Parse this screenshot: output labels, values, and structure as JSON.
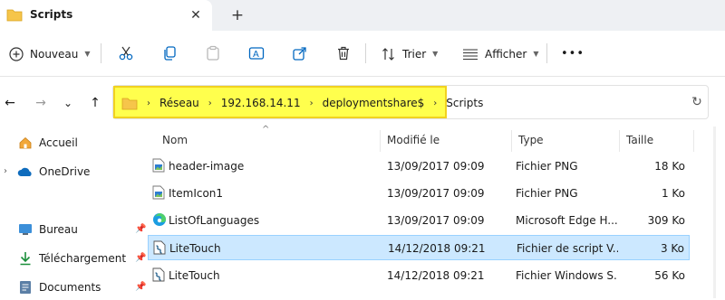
{
  "tab": {
    "title": "Scripts",
    "close": "✕",
    "new_tab": "+"
  },
  "toolbar": {
    "new_label": "Nouveau",
    "sort_label": "Trier",
    "view_label": "Afficher",
    "more": "•••"
  },
  "nav": {
    "back": "←",
    "forward": "→",
    "recent": "⌄",
    "up": "↑"
  },
  "breadcrumb": [
    "Réseau",
    "192.168.14.11",
    "deploymentshare$",
    "Scripts"
  ],
  "breadcrumb_sep": "›",
  "sidebar": {
    "items": [
      {
        "label": "Accueil",
        "icon": "home-icon"
      },
      {
        "label": "OneDrive",
        "icon": "cloud-icon"
      },
      {
        "label": "Bureau",
        "icon": "desktop-icon"
      },
      {
        "label": "Téléchargement",
        "icon": "download-icon"
      },
      {
        "label": "Documents",
        "icon": "documents-icon"
      }
    ]
  },
  "columns": {
    "name": "Nom",
    "modified": "Modifié le",
    "type": "Type",
    "size": "Taille"
  },
  "files": [
    {
      "name": "header-image",
      "modified": "13/09/2017 09:09",
      "type": "Fichier PNG",
      "size": "18 Ko",
      "icon": "image-file-icon",
      "selected": false
    },
    {
      "name": "ItemIcon1",
      "modified": "13/09/2017 09:09",
      "type": "Fichier PNG",
      "size": "1 Ko",
      "icon": "image-file-icon",
      "selected": false
    },
    {
      "name": "ListOfLanguages",
      "modified": "13/09/2017 09:09",
      "type": "Microsoft Edge H...",
      "size": "309 Ko",
      "icon": "edge-icon",
      "selected": false
    },
    {
      "name": "LiteTouch",
      "modified": "14/12/2018 09:21",
      "type": "Fichier de script V...",
      "size": "3 Ko",
      "icon": "script-file-icon",
      "selected": true
    },
    {
      "name": "LiteTouch",
      "modified": "14/12/2018 09:21",
      "type": "Fichier Windows S...",
      "size": "56 Ko",
      "icon": "script-file-icon",
      "selected": false
    }
  ],
  "colors": {
    "highlight": "#ffff4d",
    "highlight_border": "#f1d21f",
    "selection": "#cce8ff",
    "folder": "#f6c54a",
    "accent": "#0067c0"
  }
}
